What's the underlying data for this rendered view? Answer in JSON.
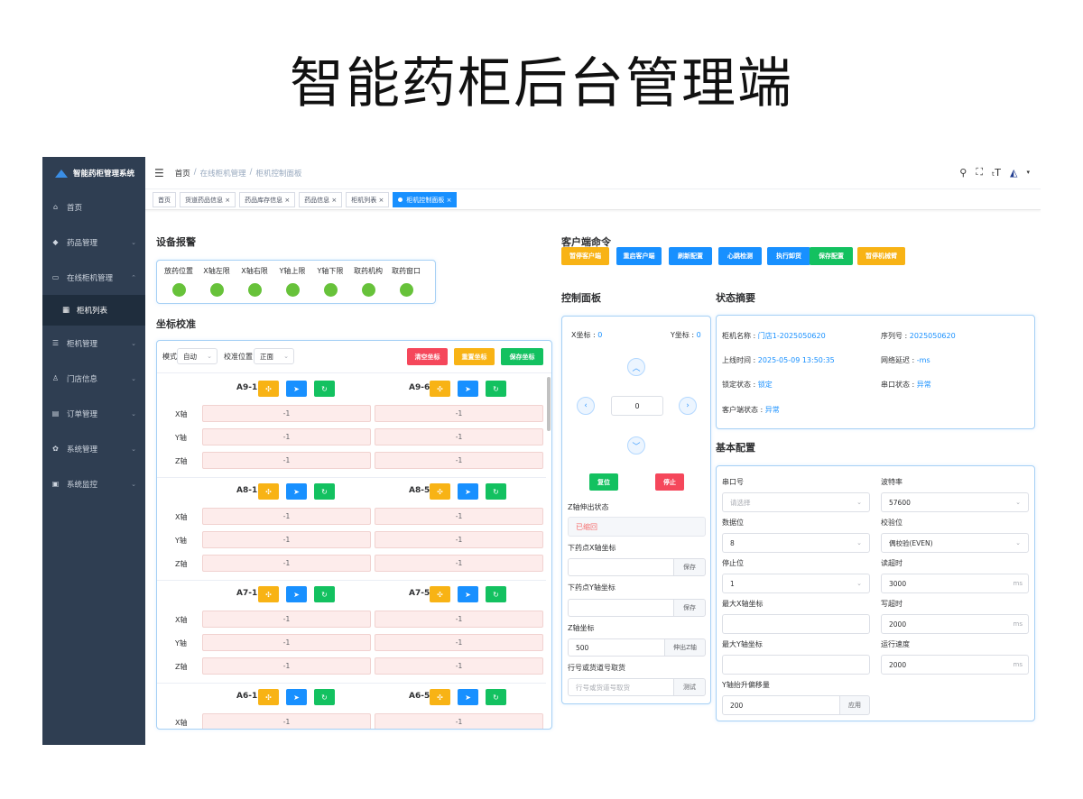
{
  "page_title": "智能药柜后台管理端",
  "sidebar": {
    "logo_text": "智能药柜管理系统",
    "items": [
      {
        "label": "首页",
        "icon": "dashboard-icon"
      },
      {
        "label": "药品管理",
        "icon": "drug-icon"
      },
      {
        "label": "在线柜机管理",
        "icon": "monitor-icon"
      },
      {
        "label": "柜机列表",
        "icon": "grid-icon"
      },
      {
        "label": "柜机管理",
        "icon": "list-icon"
      },
      {
        "label": "门店信息",
        "icon": "store-icon"
      },
      {
        "label": "订单管理",
        "icon": "order-icon"
      },
      {
        "label": "系统管理",
        "icon": "gear-icon"
      },
      {
        "label": "系统监控",
        "icon": "monitor-check-icon"
      }
    ]
  },
  "header": {
    "breadcrumb": [
      "首页",
      "/",
      "在线柜机管理",
      "/",
      "柜机控制面板"
    ]
  },
  "tags": [
    "首页",
    "货道药品信息 ×",
    "药品库存信息 ×",
    "药品信息 ×",
    "柜机列表 ×",
    "柜机控制面板 ×"
  ],
  "alarm": {
    "title": "设备报警",
    "items": [
      "放药位置",
      "X轴左限",
      "X轴右限",
      "Y轴上限",
      "Y轴下限",
      "取药机构",
      "取药窗口"
    ]
  },
  "calibration": {
    "title": "坐标校准",
    "mode_label": "模式",
    "mode_value": "自动",
    "pos_label": "校准位置",
    "pos_value": "正面",
    "btn_clear": "清空坐标",
    "btn_reset": "重置坐标",
    "btn_save": "保存坐标",
    "axes": [
      "X轴",
      "Y轴",
      "Z轴"
    ],
    "rows": [
      {
        "left": "A9-1",
        "right": "A9-6",
        "values": [
          "-1",
          "-1",
          "-1"
        ]
      },
      {
        "left": "A8-1",
        "right": "A8-5",
        "values": [
          "-1",
          "-1",
          "-1"
        ]
      },
      {
        "left": "A7-1",
        "right": "A7-5",
        "values": [
          "-1",
          "-1",
          "-1"
        ]
      },
      {
        "left": "A6-1",
        "right": "A6-5",
        "values": [
          "-1"
        ]
      }
    ]
  },
  "client_commands": {
    "title": "客户端命令",
    "buttons": [
      {
        "label": "暂停客户端",
        "color": "#f8b315"
      },
      {
        "label": "重启客户端",
        "color": "#1890ff"
      },
      {
        "label": "刷新配置",
        "color": "#1890ff"
      },
      {
        "label": "心跳检测",
        "color": "#1890ff"
      },
      {
        "label": "执行卸货",
        "color": "#1890ff"
      },
      {
        "label": "保存配置",
        "color": "#13c160"
      },
      {
        "label": "暂停机械臂",
        "color": "#f8b315"
      }
    ]
  },
  "control_panel": {
    "title": "控制面板",
    "x_label": "X坐标 :",
    "x_value": "0",
    "y_label": "Y坐标 :",
    "y_value": "0",
    "step_value": "0",
    "btn_reset": "复位",
    "btn_stop": "停止",
    "z_status_label": "Z轴伸出状态",
    "z_status_value": "已缩回",
    "drop_x_label": "下药点X轴坐标",
    "drop_y_label": "下药点Y轴坐标",
    "save": "保存",
    "z_coord_label": "Z轴坐标",
    "z_coord_value": "500",
    "z_extend_btn": "伸出Z轴",
    "fetch_label": "行号或货道号取货",
    "fetch_placeholder": "行号或货道号取货",
    "test": "测试"
  },
  "status_summary": {
    "title": "状态摘要",
    "name_label": "柜机名称 :",
    "name_value": "门店1-2025050620",
    "serial_label": "序列号 :",
    "serial_value": "2025050620",
    "online_label": "上线时间 :",
    "online_value": "2025-05-09 13:50:35",
    "latency_label": "网络延迟 :",
    "latency_value": "-ms",
    "lock_label": "锁定状态 :",
    "lock_value": "锁定",
    "port_label": "串口状态 :",
    "port_value": "异常",
    "client_label": "客户端状态 :",
    "client_value": "异常"
  },
  "basic_config": {
    "title": "基本配置",
    "serial_port_label": "串口号",
    "serial_port_placeholder": "请选择",
    "baud_label": "波特率",
    "baud_value": "57600",
    "data_bits_label": "数据位",
    "data_bits_value": "8",
    "parity_label": "校验位",
    "parity_value": "偶校验(EVEN)",
    "stop_bits_label": "停止位",
    "stop_bits_value": "1",
    "read_timeout_label": "读超时",
    "read_timeout_value": "3000",
    "max_x_label": "最大X轴坐标",
    "write_timeout_label": "写超时",
    "write_timeout_value": "2000",
    "max_y_label": "最大Y轴坐标",
    "speed_label": "运行速度",
    "speed_value": "2000",
    "lift_label": "Y轴抬升偏移量",
    "lift_value": "200",
    "apply": "应用",
    "unit_ms": "ms"
  }
}
